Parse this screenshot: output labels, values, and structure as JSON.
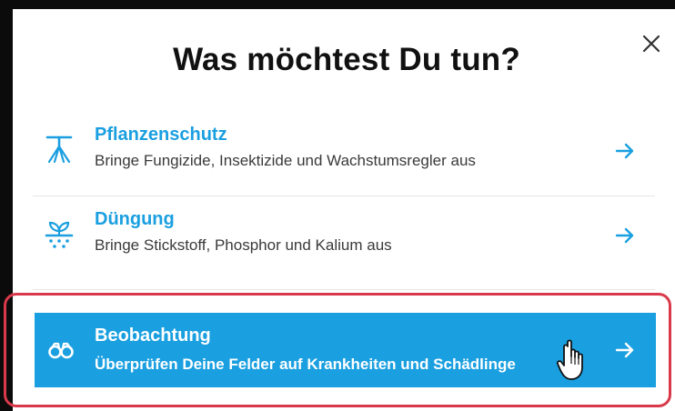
{
  "dialog": {
    "title": "Was möchtest Du tun?",
    "close_icon": "close-icon"
  },
  "options": [
    {
      "title": "Pflanzenschutz",
      "description": "Bringe Fungizide, Insektizide und Wachstumsregler aus",
      "icon": "sprayer-icon"
    },
    {
      "title": "Düngung",
      "description": "Bringe Stickstoff, Phosphor und Kalium aus",
      "icon": "fertilizer-icon"
    },
    {
      "title": "Beobachtung",
      "description": "Überprüfen Deine Felder auf Krankheiten und Schädlinge",
      "icon": "binoculars-icon",
      "highlighted": true
    }
  ],
  "colors": {
    "accent": "#1a9fe0",
    "highlight_border": "#d9394a",
    "title_text": "#111111",
    "body_text": "#3a3a3a"
  }
}
